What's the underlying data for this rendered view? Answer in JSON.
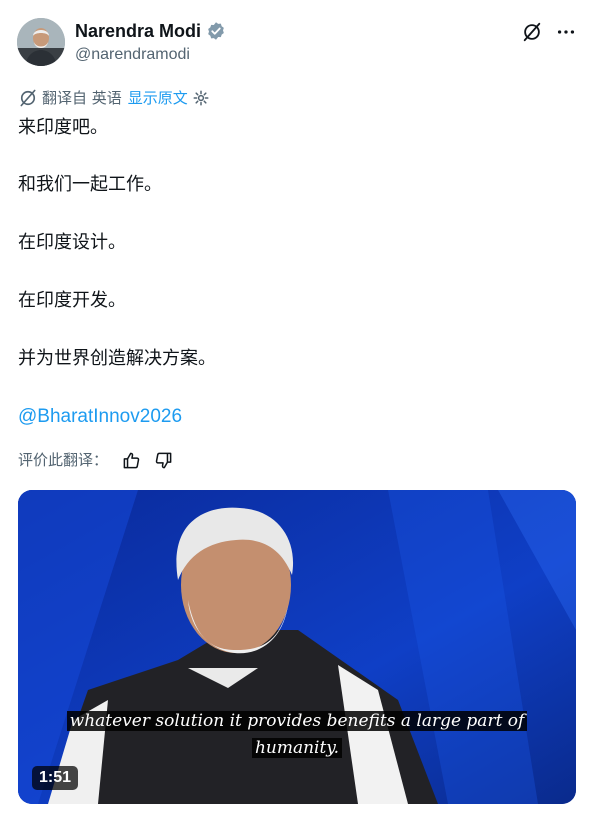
{
  "author": {
    "name": "Narendra Modi",
    "handle": "@narendramodi",
    "verified": true,
    "verified_color": "#829aab"
  },
  "translation": {
    "translated_from": "翻译自 英语",
    "show_original": "显示原文"
  },
  "post": {
    "lines": [
      "来印度吧。",
      "和我们一起工作。",
      "在印度设计。",
      "在印度开发。",
      "并为世界创造解决方案。"
    ],
    "mention": "@BharatInnov2026"
  },
  "rating": {
    "label": "评价此翻译："
  },
  "video": {
    "caption_line1": "whatever solution it provides benefits a large part of",
    "caption_line2": "humanity.",
    "duration": "1:51"
  },
  "icons": {
    "grok": "slashed-circle-icon",
    "more": "more-icon",
    "translate": "translate-icon",
    "settings": "gear-icon",
    "thumbs_up": "thumbs-up-icon",
    "thumbs_down": "thumbs-down-icon"
  },
  "colors": {
    "link": "#1d9bf0",
    "secondary_text": "#536471",
    "video_bg": "#0b2ea0"
  }
}
